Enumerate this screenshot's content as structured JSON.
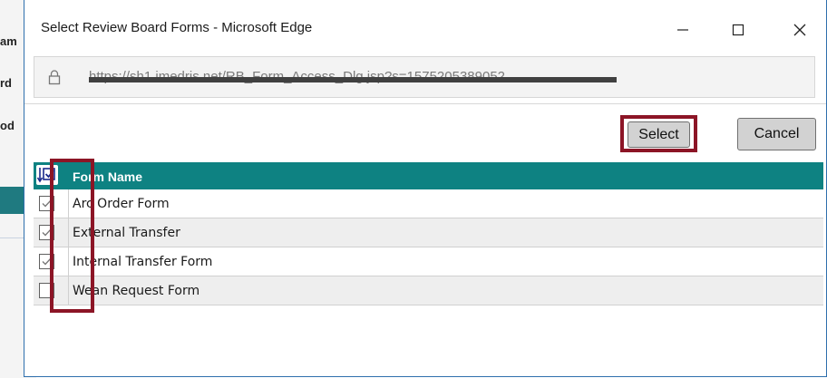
{
  "background_app": {
    "fragments": [
      "am",
      "rd",
      "od"
    ]
  },
  "window": {
    "title": "Select Review Board Forms - Microsoft Edge",
    "url": "https://sh1.imedris.net/RB_Form_Access_Dlg.jsp?s=1575205389052",
    "controls": {
      "minimize": "minimize-icon",
      "maximize": "maximize-icon",
      "close": "close-icon"
    }
  },
  "toolbar": {
    "select_label": "Select",
    "cancel_label": "Cancel"
  },
  "table": {
    "header": {
      "form_name": "Form Name"
    },
    "rows": [
      {
        "name": "Arc Order Form",
        "checked": true
      },
      {
        "name": "External Transfer",
        "checked": true
      },
      {
        "name": "Internal Transfer Form",
        "checked": true
      },
      {
        "name": "Wean Request Form",
        "checked": false
      }
    ]
  },
  "colors": {
    "header_bg": "#0e8282",
    "highlight": "#8c1526",
    "accent_border": "#2f6fad"
  }
}
